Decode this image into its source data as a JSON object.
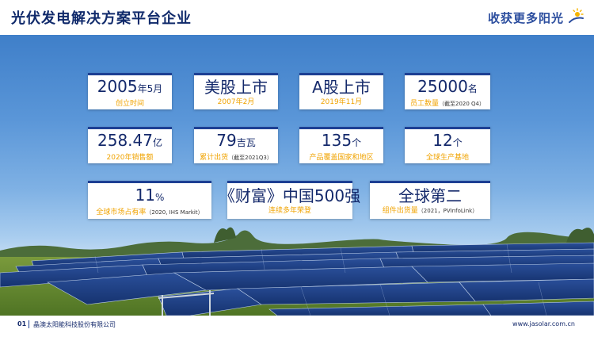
{
  "header": {
    "title": "光伏发电解决方案平台企业",
    "slogan": "收获更多阳光"
  },
  "stats": [
    {
      "value": "2005",
      "unit": "年5月",
      "label": "创立时间",
      "note": ""
    },
    {
      "value": "美股上市",
      "unit": "",
      "label": "2007年2月",
      "note": ""
    },
    {
      "value": "A股上市",
      "unit": "",
      "label": "2019年11月",
      "note": ""
    },
    {
      "value": "25000",
      "unit": "名",
      "label": "员工数量",
      "note": "（截至2020 Q4）"
    },
    {
      "value": "258.47",
      "unit": "亿",
      "label": "2020年销售额",
      "note": ""
    },
    {
      "value": "79",
      "unit": "吉瓦",
      "label": "累计出货",
      "note": "（截至2021Q3）"
    },
    {
      "value": "135",
      "unit": "个",
      "label": "产品覆盖国家和地区",
      "note": ""
    },
    {
      "value": "12",
      "unit": "个",
      "label": "全球生产基地",
      "note": ""
    },
    {
      "value": "11",
      "unit": "%",
      "label": "全球市场占有率",
      "note": "（2020, IHS Markit）"
    },
    {
      "value": "《财富》中国500强",
      "unit": "",
      "label": "连续多年荣登",
      "note": ""
    },
    {
      "value": "全球第二",
      "unit": "",
      "label": "组件出货量",
      "note": "（2021，PVInfoLink）"
    }
  ],
  "footer": {
    "page_number": "01",
    "company": "晶澳太阳能科技股份有限公司",
    "website": "www.jasolar.com.cn"
  }
}
